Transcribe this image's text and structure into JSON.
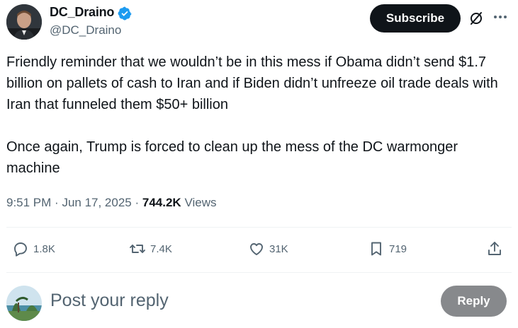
{
  "author": {
    "display_name": "DC_Draino",
    "handle": "@DC_Draino",
    "verified_color": "#1d9bf0"
  },
  "header": {
    "subscribe_label": "Subscribe",
    "icons": [
      "grok-icon",
      "more-icon"
    ]
  },
  "tweet": {
    "text": "Friendly reminder that we wouldn’t be in this mess if Obama didn’t send $1.7 billion on pallets of cash to Iran and if Biden didn’t unfreeze oil trade deals with Iran that funneled them $50+ billion\n\nOnce again, Trump is forced to clean up the mess of the DC warmonger machine",
    "time": "9:51 PM",
    "date": "Jun 17, 2025",
    "views_count": "744.2K",
    "views_label": "Views"
  },
  "actions": {
    "replies": "1.8K",
    "reposts": "7.4K",
    "likes": "31K",
    "bookmarks": "719"
  },
  "reply_box": {
    "placeholder": "Post your reply",
    "button_label": "Reply"
  }
}
